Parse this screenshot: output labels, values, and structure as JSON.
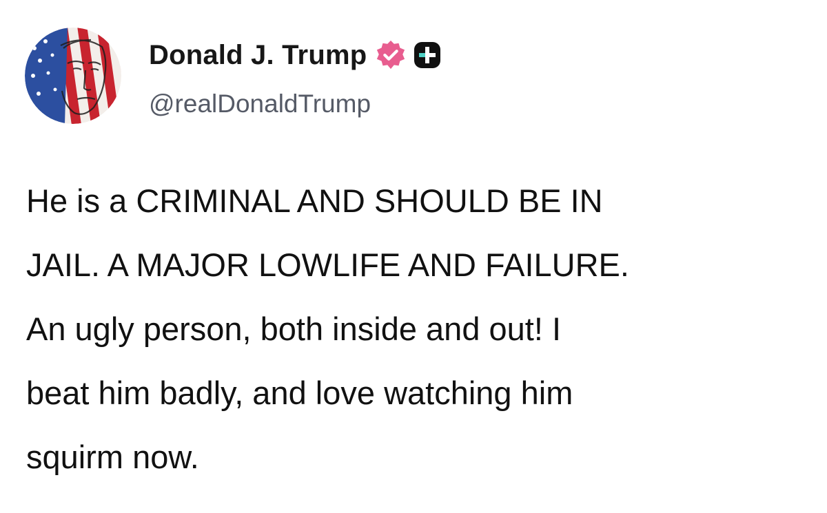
{
  "author": {
    "display_name": "Donald J. Trump",
    "handle": "@realDonaldTrump",
    "verified_icon": "verified-check-icon",
    "badge_icon": "plus-badge-icon",
    "avatar_icon": "avatar-flag-portrait"
  },
  "post": {
    "text": "He is a CRIMINAL AND SHOULD BE IN\nJAIL. A MAJOR LOWLIFE AND FAILURE.\nAn ugly person, both inside and out! I\nbeat him badly, and love watching him\nsquirm now."
  },
  "colors": {
    "verified_badge": "#e85d8f",
    "plus_badge": "#111111",
    "flag_red": "#c8242f",
    "flag_blue": "#2c4fa0"
  }
}
